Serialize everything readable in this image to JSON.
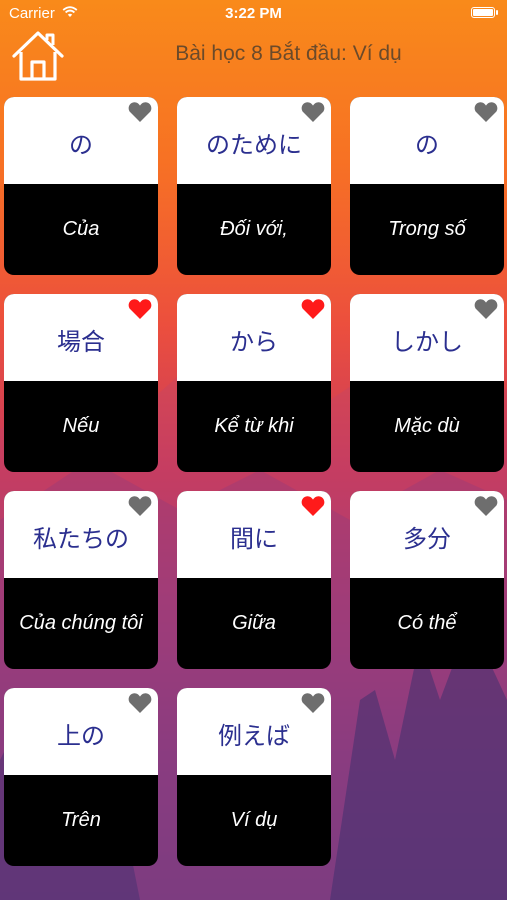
{
  "status_bar": {
    "carrier": "Carrier",
    "time": "3:22 PM"
  },
  "header": {
    "title": "Bài học 8 Bắt đầu: Ví dụ"
  },
  "colors": {
    "favorite": "#ff1a1a",
    "not_favorite": "#6e6e6e",
    "japanese_text": "#2b2f8f"
  },
  "cards": [
    {
      "japanese": "の",
      "meaning": "Của",
      "favorite": false
    },
    {
      "japanese": "のために",
      "meaning": "Đối với,",
      "favorite": false
    },
    {
      "japanese": "の",
      "meaning": "Trong số",
      "favorite": false
    },
    {
      "japanese": "場合",
      "meaning": "Nếu",
      "favorite": true
    },
    {
      "japanese": "から",
      "meaning": "Kể từ khi",
      "favorite": true
    },
    {
      "japanese": "しかし",
      "meaning": "Mặc dù",
      "favorite": false
    },
    {
      "japanese": "私たちの",
      "meaning": "Của chúng tôi",
      "favorite": false
    },
    {
      "japanese": "間に",
      "meaning": "Giữa",
      "favorite": true
    },
    {
      "japanese": "多分",
      "meaning": "Có thể",
      "favorite": false
    },
    {
      "japanese": "上の",
      "meaning": "Trên",
      "favorite": false
    },
    {
      "japanese": "例えば",
      "meaning": "Ví dụ",
      "favorite": false
    }
  ]
}
